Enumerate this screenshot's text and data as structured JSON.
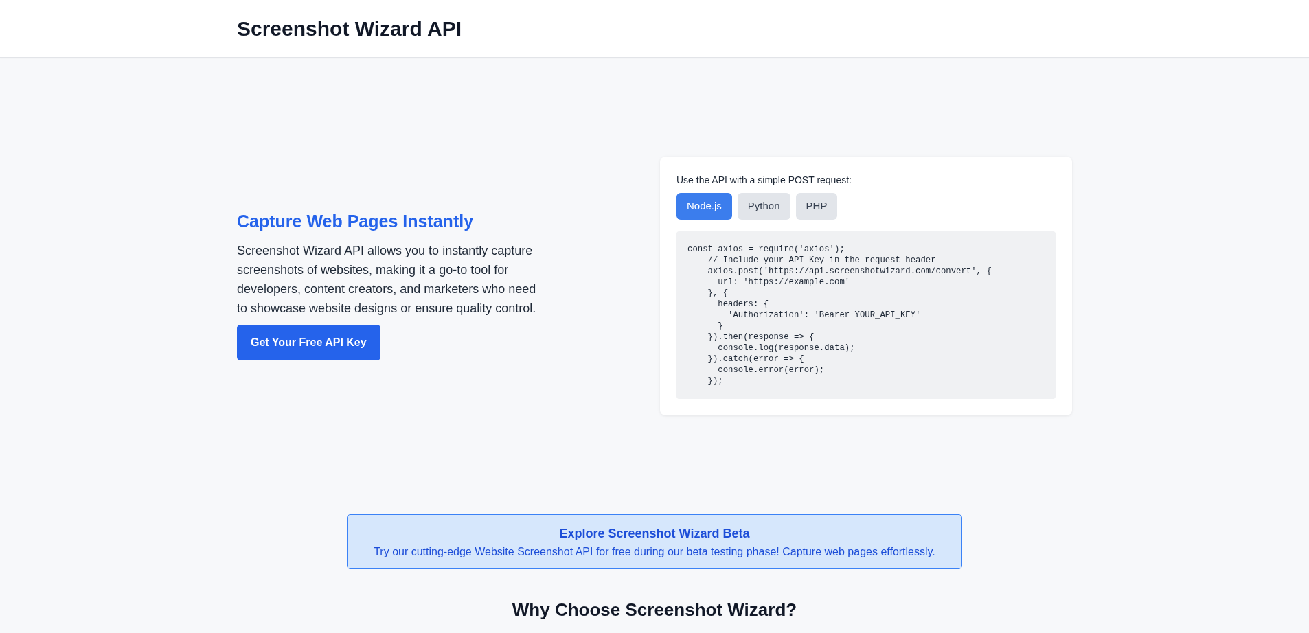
{
  "header": {
    "title": "Screenshot Wizard API"
  },
  "hero": {
    "heading": "Capture Web Pages Instantly",
    "text": "Screenshot Wizard API allows you to instantly capture screenshots of websites, making it a go-to tool for developers, content creators, and marketers who need to showcase website designs or ensure quality control.",
    "button": "Get Your Free API Key"
  },
  "api_card": {
    "intro": "Use the API with a simple POST request:",
    "tabs": [
      {
        "label": "Node.js",
        "selected": true
      },
      {
        "label": "Python",
        "selected": false
      },
      {
        "label": "PHP",
        "selected": false
      }
    ],
    "code": "const axios = require('axios');\n    // Include your API Key in the request header\n    axios.post('https://api.screenshotwizard.com/convert', {\n      url: 'https://example.com'\n    }, {\n      headers: {\n        'Authorization': 'Bearer YOUR_API_KEY'\n      }\n    }).then(response => {\n      console.log(response.data);\n    }).catch(error => {\n      console.error(error);\n    });"
  },
  "beta_banner": {
    "title": "Explore Screenshot Wizard Beta",
    "text": "Try our cutting-edge Website Screenshot API for free during our beta testing phase! Capture web pages effortlessly."
  },
  "section_heading": "Why Choose Screenshot Wizard?"
}
